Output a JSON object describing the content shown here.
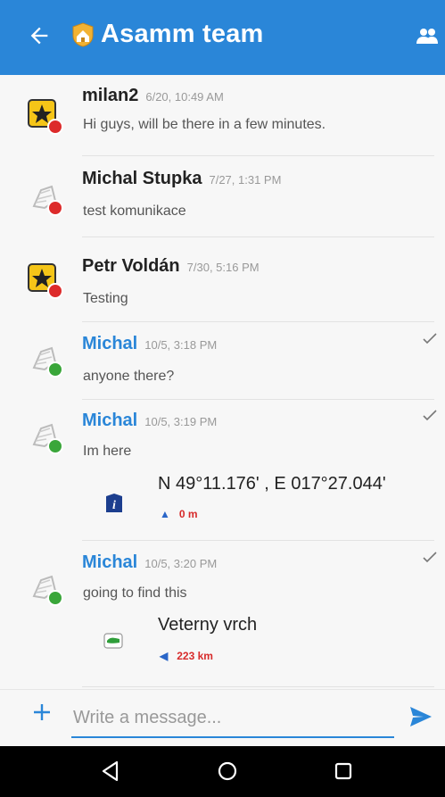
{
  "header": {
    "title": "Asamm team",
    "colors": {
      "bar": "#2a86d8",
      "text": "#ffffff"
    }
  },
  "messages": [
    {
      "name": "milan2",
      "time": "6/20, 10:49 AM",
      "text": "Hi guys, will be there in a few minutes.",
      "mine": false,
      "status": "red"
    },
    {
      "name": "Michal Stupka",
      "time": "7/27, 1:31 PM",
      "text": "test komunikace",
      "mine": false,
      "status": "red"
    },
    {
      "name": "Petr Voldán",
      "time": "7/30, 5:16 PM",
      "text": "Testing",
      "mine": false,
      "status": "red"
    },
    {
      "name": "Michal",
      "time": "10/5, 3:18 PM",
      "text": "anyone there?",
      "mine": true,
      "status": "green"
    },
    {
      "name": "Michal",
      "time": "10/5, 3:19 PM",
      "text": "Im here",
      "mine": true,
      "status": "green",
      "attachment": {
        "title": "N 49°11.176' , E 017°27.044'",
        "distance": "0 m",
        "icon": "info-point-icon"
      }
    },
    {
      "name": "Michal",
      "time": "10/5, 3:20 PM",
      "text": "going to find this",
      "mine": true,
      "status": "green",
      "attachment": {
        "title": "Veterny vrch",
        "distance": "223 km",
        "icon": "map-point-icon"
      }
    }
  ],
  "composer": {
    "placeholder": "Write a message..."
  },
  "colors": {
    "accent": "#2a86d8",
    "online": "#3aa63a",
    "offline": "#dd2b2b",
    "distance": "#d72b2b"
  }
}
